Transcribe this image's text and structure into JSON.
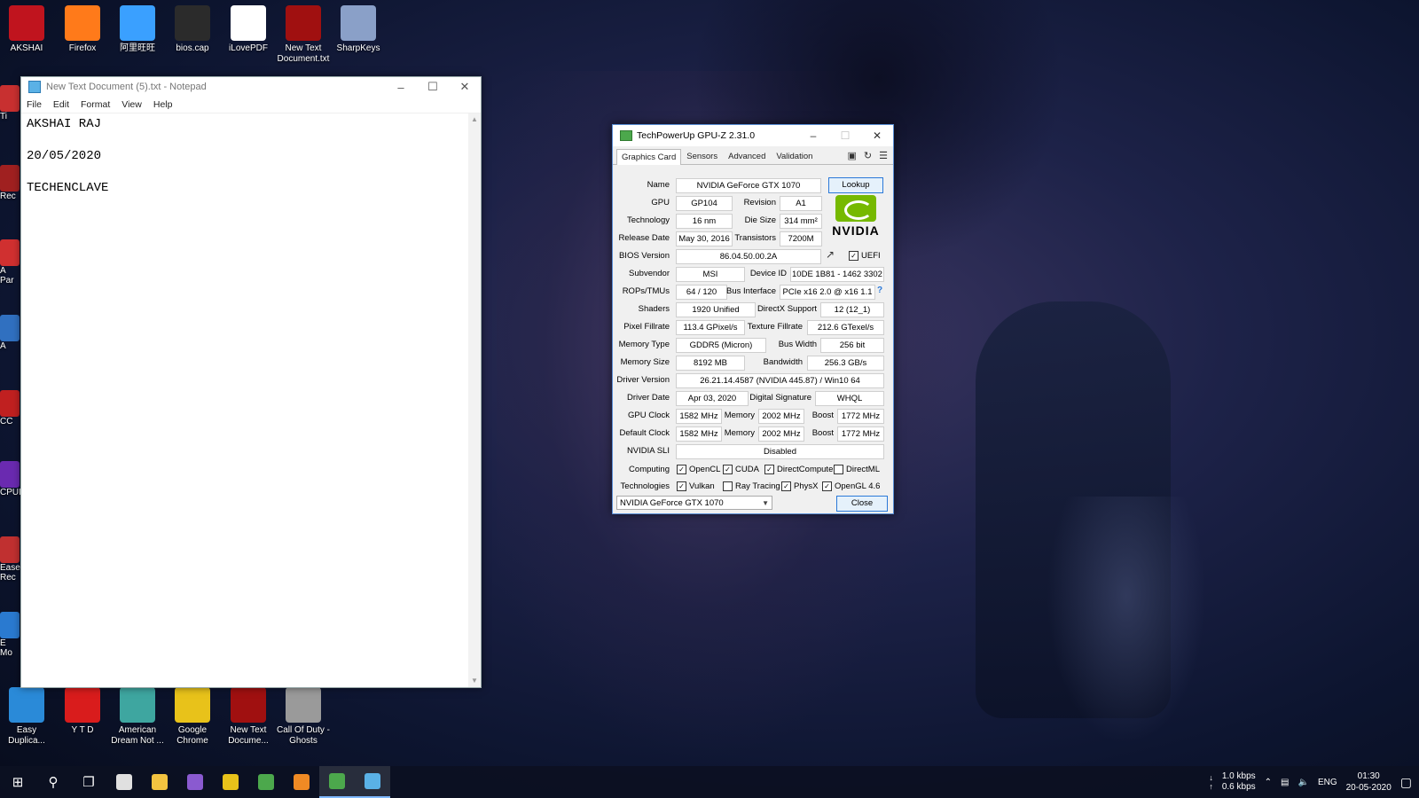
{
  "desktop": {
    "top_icons": [
      {
        "label": "AKSHAI",
        "icon": "akshai-icon",
        "color": "#c0141e"
      },
      {
        "label": "Firefox",
        "icon": "firefox-icon",
        "color": "#ff7a1a"
      },
      {
        "label": "阿里旺旺",
        "icon": "aliwangwang-icon",
        "color": "#3aa0ff"
      },
      {
        "label": "bios.cap",
        "icon": "file-icon",
        "color": "#2b2b2b"
      },
      {
        "label": "iLovePDF",
        "icon": "pdf-icon",
        "color": "#ffffff"
      },
      {
        "label": "New Text Document.txt",
        "icon": "text-file-icon",
        "color": "#a01010"
      },
      {
        "label": "SharpKeys",
        "icon": "keyboard-icon",
        "color": "#8aa0c8"
      }
    ],
    "bottom_icons": [
      {
        "label": "Easy Duplica...",
        "icon": "edf-icon",
        "color": "#2a8ad8"
      },
      {
        "label": "Y T D",
        "icon": "download-icon",
        "color": "#d91c1c"
      },
      {
        "label": "American Dream Not ...",
        "icon": "music-icon",
        "color": "#3ea6a0"
      },
      {
        "label": "Google Chrome",
        "icon": "chrome-icon",
        "color": "#e8c21a"
      },
      {
        "label": "New Text Docume...",
        "icon": "text-file-icon",
        "color": "#a01010"
      },
      {
        "label": "Call Of Duty - Ghosts",
        "icon": "cod-icon",
        "color": "#9a9a9a"
      }
    ],
    "side_icons": [
      {
        "label": "Ti",
        "color": "#c83030"
      },
      {
        "label": "Rec",
        "color": "#a02020"
      },
      {
        "label": "A Par",
        "color": "#d03030"
      },
      {
        "label": "A",
        "color": "#3070c0"
      },
      {
        "label": "CC",
        "color": "#c02020"
      },
      {
        "label": "CPUI",
        "color": "#6a2ab0"
      },
      {
        "label": "Ease Rec",
        "color": "#c03030"
      },
      {
        "label": "E Mo",
        "color": "#2a7ad0"
      }
    ]
  },
  "notepad": {
    "title": "New Text Document (5).txt - Notepad",
    "menu": [
      "File",
      "Edit",
      "Format",
      "View",
      "Help"
    ],
    "lines": [
      "AKSHAI RAJ",
      "",
      "20/05/2020",
      "",
      "TECHENCLAVE"
    ]
  },
  "gpuz": {
    "title": "TechPowerUp GPU-Z 2.31.0",
    "tabs": [
      "Graphics Card",
      "Sensors",
      "Advanced",
      "Validation"
    ],
    "labels": {
      "name": "Name",
      "gpu": "GPU",
      "revision": "Revision",
      "technology": "Technology",
      "die_size": "Die Size",
      "release_date": "Release Date",
      "transistors": "Transistors",
      "bios_version": "BIOS Version",
      "subvendor": "Subvendor",
      "device_id": "Device ID",
      "rops_tmus": "ROPs/TMUs",
      "bus_interface": "Bus Interface",
      "shaders": "Shaders",
      "directx_support": "DirectX Support",
      "pixel_fillrate": "Pixel Fillrate",
      "texture_fillrate": "Texture Fillrate",
      "memory_type": "Memory Type",
      "bus_width": "Bus Width",
      "memory_size": "Memory Size",
      "bandwidth": "Bandwidth",
      "driver_version": "Driver Version",
      "driver_date": "Driver Date",
      "digital_signature": "Digital Signature",
      "gpu_clock": "GPU Clock",
      "memory": "Memory",
      "boost": "Boost",
      "default_clock": "Default Clock",
      "nvidia_sli": "NVIDIA SLI",
      "computing": "Computing",
      "technologies": "Technologies"
    },
    "values": {
      "name": "NVIDIA GeForce GTX 1070",
      "gpu": "GP104",
      "revision": "A1",
      "technology": "16 nm",
      "die_size": "314 mm²",
      "release_date": "May 30, 2016",
      "transistors": "7200M",
      "bios_version": "86.04.50.00.2A",
      "subvendor": "MSI",
      "device_id": "10DE 1B81 - 1462 3302",
      "rops_tmus": "64 / 120",
      "bus_interface": "PCIe x16 2.0 @ x16 1.1",
      "shaders": "1920 Unified",
      "directx_support": "12 (12_1)",
      "pixel_fillrate": "113.4 GPixel/s",
      "texture_fillrate": "212.6 GTexel/s",
      "memory_type": "GDDR5 (Micron)",
      "bus_width": "256 bit",
      "memory_size": "8192 MB",
      "bandwidth": "256.3 GB/s",
      "driver_version": "26.21.14.4587 (NVIDIA 445.87) / Win10 64",
      "driver_date": "Apr 03, 2020",
      "digital_signature": "WHQL",
      "gpu_clock": "1582 MHz",
      "gpu_memory": "2002 MHz",
      "gpu_boost": "1772 MHz",
      "default_clock": "1582 MHz",
      "default_memory": "2002 MHz",
      "default_boost": "1772 MHz",
      "nvidia_sli": "Disabled"
    },
    "lookup_label": "Lookup",
    "uefi_label": "UEFI",
    "uefi_checked": true,
    "brand_text": "NVIDIA",
    "computing": [
      {
        "label": "OpenCL",
        "checked": true
      },
      {
        "label": "CUDA",
        "checked": true
      },
      {
        "label": "DirectCompute",
        "checked": true
      },
      {
        "label": "DirectML",
        "checked": false
      }
    ],
    "technologies": [
      {
        "label": "Vulkan",
        "checked": true
      },
      {
        "label": "Ray Tracing",
        "checked": false
      },
      {
        "label": "PhysX",
        "checked": true
      },
      {
        "label": "OpenGL 4.6",
        "checked": true
      }
    ],
    "selected_gpu": "NVIDIA GeForce GTX 1070",
    "close_label": "Close"
  },
  "taskbar": {
    "apps": [
      {
        "icon": "clapper-icon",
        "color": "#e0e0e0"
      },
      {
        "icon": "file-explorer-icon",
        "color": "#f3c340"
      },
      {
        "icon": "visual-studio-icon",
        "color": "#8a5ad0"
      },
      {
        "icon": "chrome-icon",
        "color": "#e8c21a"
      },
      {
        "icon": "app-green-icon",
        "color": "#4ca84c"
      },
      {
        "icon": "media-player-icon",
        "color": "#f08a24"
      },
      {
        "icon": "gpuz-icon",
        "color": "#4ca84c",
        "active": true
      },
      {
        "icon": "notepad-icon",
        "color": "#5ab1e6",
        "active": true
      }
    ],
    "net_down": "1.0 kbps",
    "net_up": "0.6 kbps",
    "language": "ENG",
    "time": "01:30",
    "date": "20-05-2020"
  }
}
